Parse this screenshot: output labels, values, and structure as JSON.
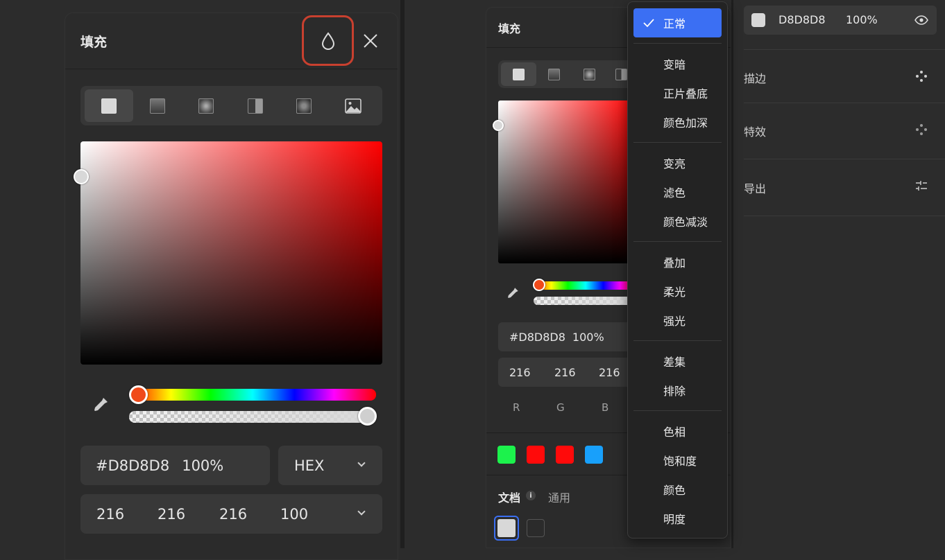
{
  "fill_panel": {
    "title": "填充",
    "hex_value": "#D8D8D8",
    "opacity": "100%",
    "format": "HEX",
    "rgba": [
      "216",
      "216",
      "216",
      "100"
    ],
    "fill_types": [
      "solid-fill-icon",
      "linear-gradient-icon",
      "radial-gradient-icon",
      "angular-gradient-icon",
      "diamond-gradient-icon",
      "image-fill-icon"
    ]
  },
  "mid_panel": {
    "title": "填充",
    "hex_value": "#D8D8D8",
    "opacity": "100%",
    "rgb": [
      "216",
      "216",
      "216"
    ],
    "rgb_labels": [
      "R",
      "G",
      "B"
    ],
    "recent_swatches": [
      "#1cf24c",
      "#ff0a0a",
      "#ff0a0a",
      "#18a0fb"
    ],
    "doc_tab": "文档",
    "common_tab": "通用",
    "doc_swatches": [
      "#d8d8d8",
      "#2b2b2b"
    ]
  },
  "blend_menu": {
    "groups": [
      [
        "正常"
      ],
      [
        "变暗",
        "正片叠底",
        "颜色加深"
      ],
      [
        "变亮",
        "滤色",
        "颜色减淡"
      ],
      [
        "叠加",
        "柔光",
        "强光"
      ],
      [
        "差集",
        "排除"
      ],
      [
        "色相",
        "饱和度",
        "颜色",
        "明度"
      ]
    ],
    "selected": "正常"
  },
  "right_panel": {
    "fill_hex": "D8D8D8",
    "fill_opacity": "100%",
    "stroke_label": "描边",
    "effects_label": "特效",
    "export_label": "导出"
  },
  "colors": {
    "accent": "#3b6ff3",
    "highlight_ring": "#c8402f",
    "panel_bg": "#2b2b2b"
  }
}
